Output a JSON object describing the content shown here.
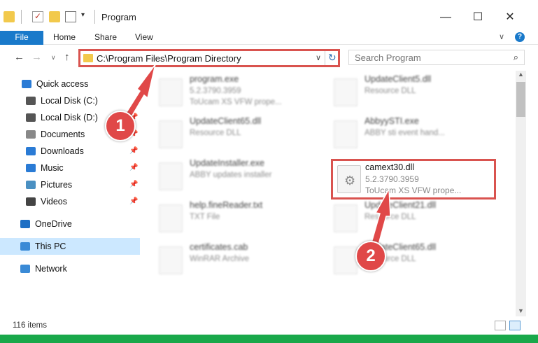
{
  "window": {
    "title": "Program",
    "minimize": "—",
    "maximize": "☐",
    "close": "✕"
  },
  "ribbon": {
    "file": "File",
    "home": "Home",
    "share": "Share",
    "view": "View",
    "expand": "∨",
    "help": "?"
  },
  "nav": {
    "back": "←",
    "forward": "→",
    "recent": "∨",
    "up": "↑",
    "address": "C:\\Program Files\\Program Directory",
    "address_dropdown": "∨",
    "refresh": "↻",
    "search_placeholder": "Search Program",
    "search_icon": "⌕"
  },
  "sidebar": {
    "items": [
      {
        "label": "Quick access",
        "icon": "star-icon",
        "color": "#2a7bd5",
        "pinned": false
      },
      {
        "label": "Local Disk (C:)",
        "icon": "drive-icon",
        "color": "#555555",
        "pinned": false
      },
      {
        "label": "Local Disk (D:)",
        "icon": "drive-icon",
        "color": "#555555",
        "pinned": true
      },
      {
        "label": "Documents",
        "icon": "documents-icon",
        "color": "#888888",
        "pinned": true
      },
      {
        "label": "Downloads",
        "icon": "downloads-icon",
        "color": "#2a7bd5",
        "pinned": true
      },
      {
        "label": "Music",
        "icon": "music-icon",
        "color": "#2a7bd5",
        "pinned": true
      },
      {
        "label": "Pictures",
        "icon": "pictures-icon",
        "color": "#4a90c2",
        "pinned": true
      },
      {
        "label": "Videos",
        "icon": "videos-icon",
        "color": "#444444",
        "pinned": true
      },
      {
        "label": "OneDrive",
        "icon": "onedrive-icon",
        "color": "#1e6fc4",
        "pinned": false
      },
      {
        "label": "This PC",
        "icon": "pc-icon",
        "color": "#3a8ad6",
        "pinned": false
      },
      {
        "label": "Network",
        "icon": "network-icon",
        "color": "#3a8ad6",
        "pinned": false
      }
    ],
    "pin_glyph": "📌"
  },
  "files": [
    {
      "name": "program.exe",
      "line2": "5.2.3790.3959",
      "line3": "ToUcam XS VFW prope..."
    },
    {
      "name": "UpdateClient5.dll",
      "line2": "Resource DLL",
      "line3": ""
    },
    {
      "name": "UpdateClient65.dll",
      "line2": "Resource DLL",
      "line3": ""
    },
    {
      "name": "AbbyySTI.exe",
      "line2": "ABBY sti event hand...",
      "line3": ""
    },
    {
      "name": "UpdateInstaller.exe",
      "line2": "ABBY updates installer",
      "line3": ""
    },
    {
      "name": "help.fineReader.txt",
      "line2": "TXT File",
      "line3": ""
    },
    {
      "name": "UpdateClient21.dll",
      "line2": "Resource DLL",
      "line3": ""
    },
    {
      "name": "certificates.cab",
      "line2": "WinRAR Archive",
      "line3": ""
    },
    {
      "name": "UpdateClient65.dll",
      "line2": "Resource DLL",
      "line3": ""
    }
  ],
  "highlighted_file": {
    "name": "camext30.dll",
    "version": "5.2.3790.3959",
    "description": "ToUcam XS VFW prope...",
    "icon": "gear-icon"
  },
  "status": {
    "count": "116 items"
  },
  "callouts": {
    "one": "1",
    "two": "2",
    "color": "#e04848"
  }
}
